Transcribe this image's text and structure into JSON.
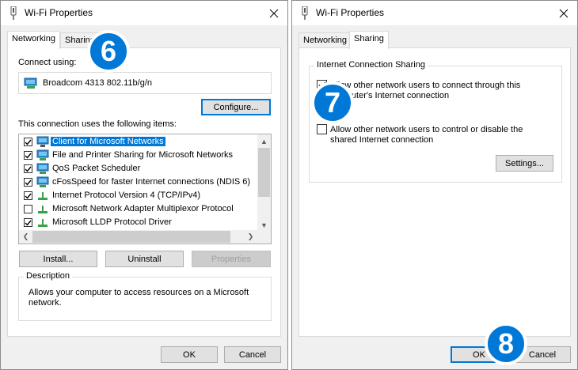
{
  "left_window": {
    "title": "Wi-Fi Properties",
    "tabs": [
      {
        "label": "Networking",
        "active": true
      },
      {
        "label": "Sharing",
        "active": false
      }
    ],
    "connect_using_label": "Connect using:",
    "adapter_name": "Broadcom 4313 802.11b/g/n",
    "configure_button": "Configure...",
    "items_label": "This connection uses the following items:",
    "items": [
      {
        "label": "Client for Microsoft Networks",
        "checked": true,
        "selected": true,
        "icon": "network-client-icon"
      },
      {
        "label": "File and Printer Sharing for Microsoft Networks",
        "checked": true,
        "selected": false,
        "icon": "network-service-icon"
      },
      {
        "label": "QoS Packet Scheduler",
        "checked": true,
        "selected": false,
        "icon": "network-service-icon"
      },
      {
        "label": "cFosSpeed for faster Internet connections (NDIS 6)",
        "checked": true,
        "selected": false,
        "icon": "network-service-icon"
      },
      {
        "label": "Internet Protocol Version 4 (TCP/IPv4)",
        "checked": true,
        "selected": false,
        "icon": "protocol-icon"
      },
      {
        "label": "Microsoft Network Adapter Multiplexor Protocol",
        "checked": false,
        "selected": false,
        "icon": "protocol-icon"
      },
      {
        "label": "Microsoft LLDP Protocol Driver",
        "checked": true,
        "selected": false,
        "icon": "protocol-icon"
      }
    ],
    "install_button": "Install...",
    "uninstall_button": "Uninstall",
    "properties_button": "Properties",
    "description_title": "Description",
    "description_text": "Allows your computer to access resources on a Microsoft network.",
    "ok_button": "OK",
    "cancel_button": "Cancel"
  },
  "right_window": {
    "title": "Wi-Fi Properties",
    "tabs": [
      {
        "label": "Networking",
        "active": false
      },
      {
        "label": "Sharing",
        "active": true
      }
    ],
    "group_title": "Internet Connection Sharing",
    "option1_text": "Allow other network users to connect through this computer's Internet connection",
    "option1_checked": true,
    "option2_text": "Allow other network users to control or disable the shared Internet connection",
    "option2_checked": false,
    "settings_button": "Settings...",
    "ok_button": "OK",
    "cancel_button": "Cancel"
  },
  "step_badges": [
    "6",
    "7",
    "8"
  ],
  "colors": {
    "accent": "#0078d7",
    "dialog_bg": "#f0f0f0",
    "button_bg": "#e1e1e1"
  }
}
